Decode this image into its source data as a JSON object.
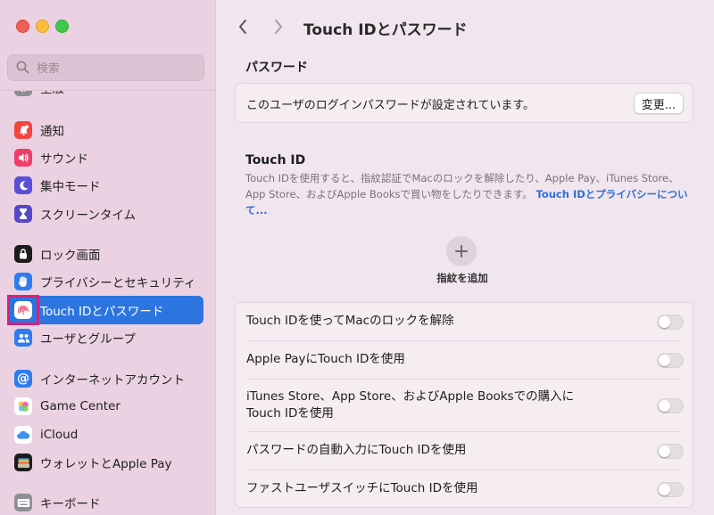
{
  "search": {
    "placeholder": "検索"
  },
  "sidebar": {
    "items": [
      {
        "label": "通知"
      },
      {
        "label": "サウンド"
      },
      {
        "label": "集中モード"
      },
      {
        "label": "スクリーンタイム"
      },
      {
        "label": "ロック画面"
      },
      {
        "label": "プライバシーとセキュリティ"
      },
      {
        "label": "Touch IDとパスワード"
      },
      {
        "label": "ユーザとグループ"
      },
      {
        "label": "インターネットアカウント"
      },
      {
        "label": "Game Center"
      },
      {
        "label": "iCloud"
      },
      {
        "label": "ウォレットとApple Pay"
      },
      {
        "label": "キーボード"
      }
    ],
    "partial_label": "全般"
  },
  "header": {
    "title": "Touch IDとパスワード"
  },
  "password": {
    "heading": "パスワード",
    "status": "このユーザのログインパスワードが設定されています。",
    "change_button": "変更..."
  },
  "touchid": {
    "heading": "Touch ID",
    "description": "Touch IDを使用すると、指紋認証でMacのロックを解除したり、Apple Pay、iTunes Store、App Store、およびApple Booksで買い物をしたりできます。",
    "link": "Touch IDとプライバシーについて...",
    "add_fingerprint": "指紋を追加"
  },
  "options": [
    {
      "label": "Touch IDを使ってMacのロックを解除",
      "enabled": false
    },
    {
      "label": "Apple PayにTouch IDを使用",
      "enabled": false
    },
    {
      "label": "iTunes Store、App Store、およびApple Booksでの購入にTouch IDを使用",
      "enabled": false
    },
    {
      "label": "パスワードの自動入力にTouch IDを使用",
      "enabled": false
    },
    {
      "label": "ファストユーザスイッチにTouch IDを使用",
      "enabled": false
    }
  ],
  "colors": {
    "accent": "#2c75e0",
    "link": "#2c6fd6",
    "highlight": "#d8217a",
    "sidebar_bg": "#ead2e2"
  }
}
